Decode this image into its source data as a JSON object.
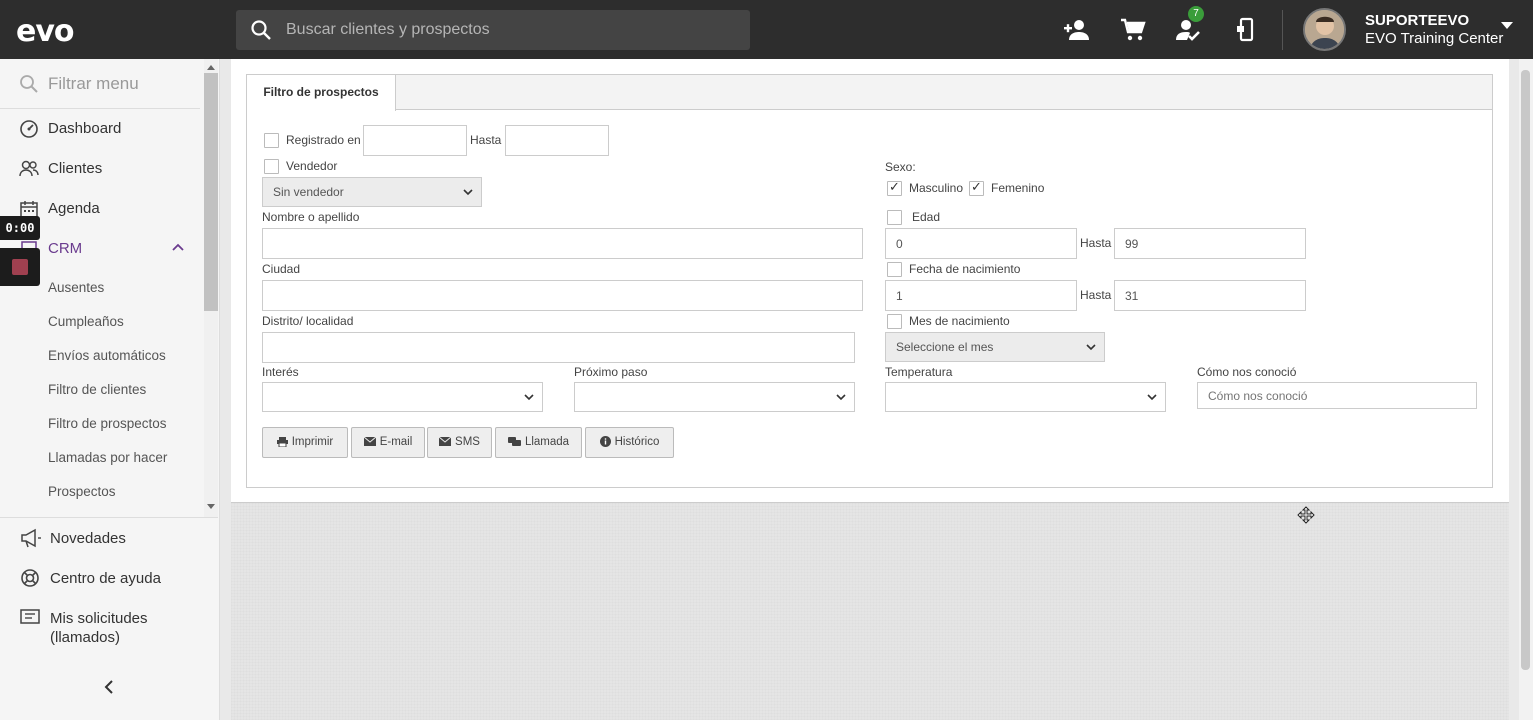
{
  "topbar": {
    "logo": "evo",
    "search_placeholder": "Buscar clientes y prospectos",
    "notification_count": "7",
    "user_name": "SUPORTEEVO",
    "user_center": "EVO Training Center"
  },
  "sidebar": {
    "filter_placeholder": "Filtrar menu",
    "items": [
      {
        "label": "Dashboard",
        "icon": "gauge-icon"
      },
      {
        "label": "Clientes",
        "icon": "users-icon"
      },
      {
        "label": "Agenda",
        "icon": "calendar-icon"
      },
      {
        "label": "CRM",
        "icon": "crm-icon"
      }
    ],
    "crm_subitems": [
      "Ausentes",
      "Cumpleaños",
      "Envíos automáticos",
      "Filtro de clientes",
      "Filtro de prospectos",
      "Llamadas por hacer",
      "Prospectos"
    ],
    "lower_items": [
      {
        "label": "Novedades",
        "icon": "megaphone-icon"
      },
      {
        "label": "Centro de ayuda",
        "icon": "lifebuoy-icon"
      },
      {
        "label": "Mis solicitudes",
        "label2": "(llamados)",
        "icon": "ticket-icon"
      }
    ]
  },
  "recorder": {
    "time": "0:00"
  },
  "form": {
    "tab": "Filtro de prospectos",
    "registrado_en": "Registrado en",
    "hasta": "Hasta",
    "vendedor": "Vendedor",
    "vendedor_value": "Sin vendedor",
    "nombre": "Nombre o apellido",
    "ciudad": "Ciudad",
    "distrito": "Distrito/ localidad",
    "interes": "Interés",
    "proximo_paso": "Próximo paso",
    "temperatura": "Temperatura",
    "como_nos_conocio": "Cómo nos conoció",
    "como_nos_conocio_placeholder": "Cómo nos conoció",
    "sexo": "Sexo:",
    "masculino": "Masculino",
    "femenino": "Femenino",
    "edad": "Edad",
    "edad_from": "0",
    "edad_to": "99",
    "fecha_nacimiento": "Fecha de nacimiento",
    "fecha_from": "1",
    "fecha_to": "31",
    "mes_nacimiento": "Mes de nacimiento",
    "mes_value": "Seleccione el mes",
    "buttons": {
      "imprimir": "Imprimir",
      "email": "E-mail",
      "sms": "SMS",
      "llamada": "Llamada",
      "historico": "Histórico"
    }
  }
}
